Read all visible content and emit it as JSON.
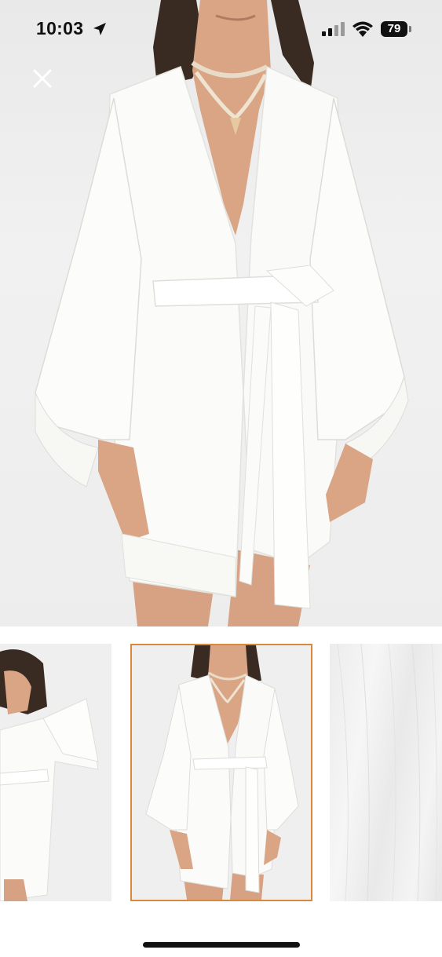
{
  "status_bar": {
    "time": "10:03",
    "battery": "79",
    "icons": [
      "location-arrow-icon",
      "cellular-signal-icon",
      "wifi-icon",
      "battery-icon"
    ]
  },
  "viewer": {
    "close_icon": "close-icon",
    "main_image": "white-kimono-robe-photo",
    "thumbnails": [
      {
        "name": "thumbnail-side-view",
        "selected": false
      },
      {
        "name": "thumbnail-front-view",
        "selected": true
      },
      {
        "name": "thumbnail-fabric-closeup",
        "selected": false
      }
    ],
    "selected_border_color": "#d9893a"
  }
}
